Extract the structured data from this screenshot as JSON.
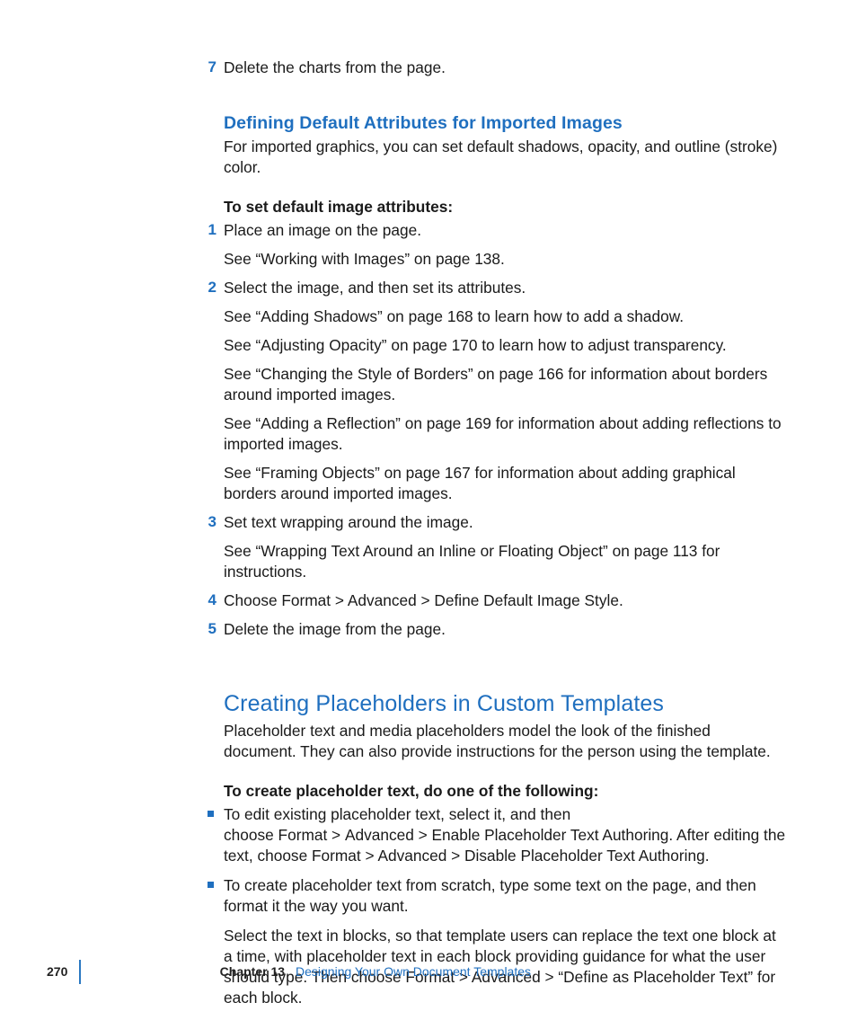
{
  "step7": {
    "num": "7",
    "text": "Delete the charts from the page."
  },
  "h2a": "Defining Default Attributes for Imported Images",
  "h2a_desc": "For imported graphics, you can set default shadows, opacity, and outline (stroke) color.",
  "h2a_intro": "To set default image attributes:",
  "s1": {
    "num": "1",
    "text": "Place an image on the page.",
    "sub": [
      "See “Working with Images” on page 138."
    ]
  },
  "s2": {
    "num": "2",
    "text": "Select the image, and then set its attributes.",
    "sub": [
      "See “Adding Shadows” on page 168 to learn how to add a shadow.",
      "See “Adjusting Opacity” on page 170 to learn how to adjust transparency.",
      "See “Changing the Style of Borders” on page 166 for information about borders around imported images.",
      "See “Adding a Reflection” on page 169 for information about adding reflections to imported images.",
      "See “Framing Objects” on page 167 for information about adding graphical borders around imported images."
    ]
  },
  "s3": {
    "num": "3",
    "text": "Set text wrapping around the image.",
    "sub": [
      "See “Wrapping Text Around an Inline or Floating Object” on page 113 for instructions."
    ]
  },
  "s4": {
    "num": "4",
    "text": "Choose Format > Advanced > Define Default Image Style."
  },
  "s5": {
    "num": "5",
    "text": "Delete the image from the page."
  },
  "h1b": "Creating Placeholders in Custom Templates",
  "h1b_desc": "Placeholder text and media placeholders model the look of the finished document. They can also provide instructions for the person using the template.",
  "h1b_intro": "To create placeholder text, do one of the following:",
  "b1": {
    "text": "To edit existing placeholder text, select it, and then choose Format > Advanced > Enable Placeholder Text Authoring. After editing the text, choose Format > Advanced > Disable Placeholder Text Authoring."
  },
  "b2": {
    "text": "To create placeholder text from scratch, type some text on the page, and then format it the way you want.",
    "sub": [
      "Select the text in blocks, so that template users can replace the text one block at a time, with placeholder text in each block providing guidance for what the user should type. Then choose Format > Advanced > “Define as Placeholder Text” for each block."
    ]
  },
  "footer": {
    "page": "270",
    "chapter": "Chapter 13",
    "title": "Designing Your Own Document Templates"
  }
}
